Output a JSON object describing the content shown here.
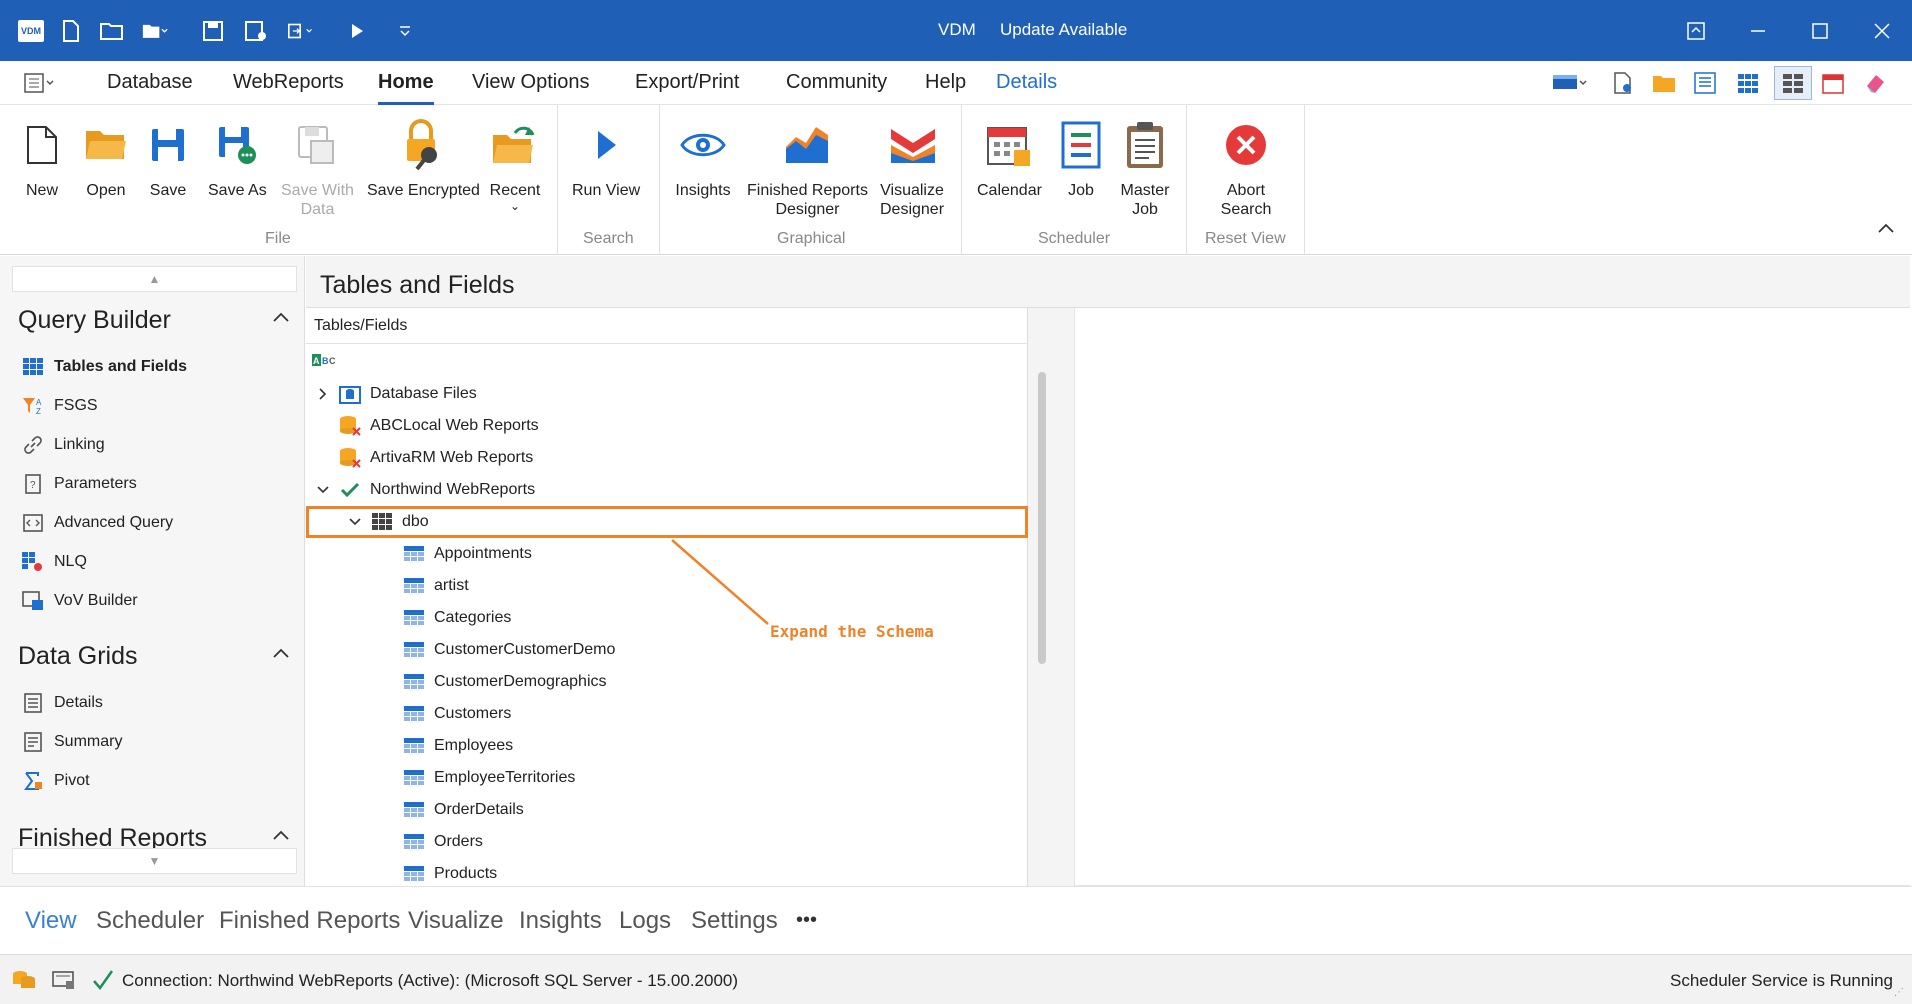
{
  "app": {
    "logo_text": "VDM",
    "title": "VDM",
    "update_notice": "Update Available"
  },
  "menu": {
    "items": [
      "Database",
      "WebReports",
      "Home",
      "View Options",
      "Export/Print",
      "Community",
      "Help",
      "Details"
    ],
    "active": "Home"
  },
  "ribbon": {
    "new": "New",
    "open": "Open",
    "save": "Save",
    "save_as": "Save As",
    "save_with_data_1": "Save With",
    "save_with_data_2": "Data",
    "save_encrypted": "Save Encrypted",
    "recent": "Recent",
    "run_view": "Run View",
    "insights": "Insights",
    "finished_reports_1": "Finished Reports",
    "finished_reports_2": "Designer",
    "visualize_1": "Visualize",
    "visualize_2": "Designer",
    "calendar": "Calendar",
    "job": "Job",
    "master_job_1": "Master",
    "master_job_2": "Job",
    "abort_1": "Abort",
    "abort_2": "Search",
    "groups": {
      "file": "File",
      "search": "Search",
      "graphical": "Graphical",
      "scheduler": "Scheduler",
      "reset_view": "Reset View"
    }
  },
  "leftnav": {
    "query_builder": {
      "title": "Query Builder",
      "items": [
        "Tables and Fields",
        "FSGS",
        "Linking",
        "Parameters",
        "Advanced Query",
        "NLQ",
        "VoV Builder"
      ]
    },
    "data_grids": {
      "title": "Data Grids",
      "items": [
        "Details",
        "Summary",
        "Pivot"
      ]
    },
    "finished_reports": {
      "title": "Finished Reports"
    }
  },
  "main": {
    "title": "Tables and Fields",
    "tree_header": "Tables/Fields",
    "tree": {
      "database_files": "Database Files",
      "abclocal": "ABCLocal Web Reports",
      "artivarm": "ArtivaRM Web Reports",
      "northwind": "Northwind WebReports",
      "schema": "dbo",
      "tables": [
        "Appointments",
        "artist",
        "Categories",
        "CustomerCustomerDemo",
        "CustomerDemographics",
        "Customers",
        "Employees",
        "EmployeeTerritories",
        "OrderDetails",
        "Orders",
        "Products"
      ]
    },
    "callout": "Expand the Schema"
  },
  "bottom_tabs": {
    "items": [
      "View",
      "Scheduler",
      "Finished Reports",
      "Visualize",
      "Insights",
      "Logs",
      "Settings"
    ],
    "more": "•••"
  },
  "status": {
    "connection": "Connection: Northwind WebReports (Active): (Microsoft SQL Server - 15.00.2000)",
    "scheduler": "Scheduler Service is Running"
  },
  "colors": {
    "titlebar": "#1f5fb6",
    "accent": "#1f6fd1",
    "highlight": "#f08228"
  }
}
